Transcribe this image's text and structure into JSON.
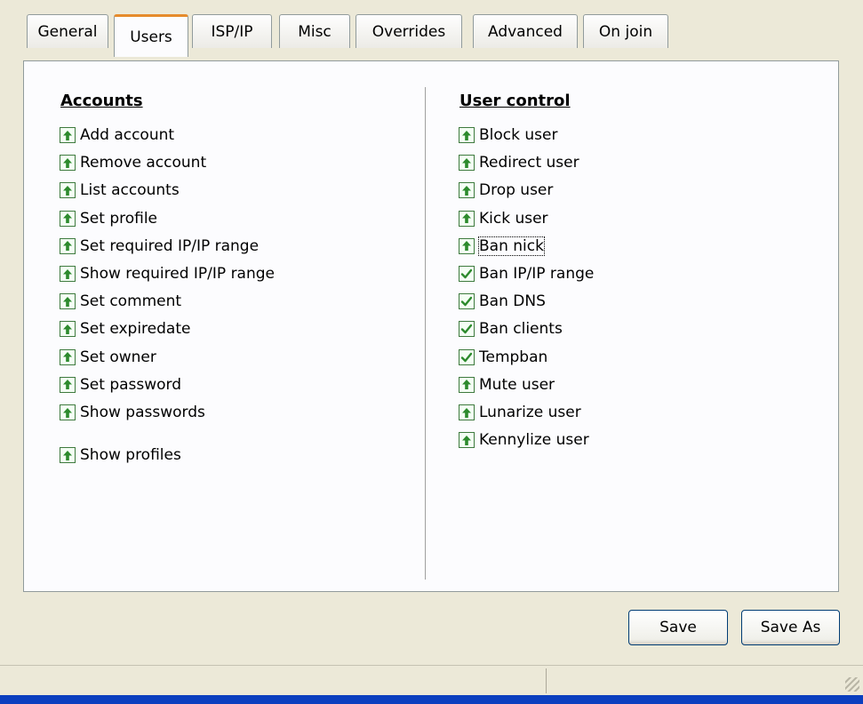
{
  "tabs": [
    "General",
    "Users",
    "ISP/IP",
    "Misc",
    "Overrides",
    "Advanced",
    "On join"
  ],
  "active_tab": "Users",
  "accounts": {
    "heading": "Accounts",
    "items": [
      {
        "label": "Add account",
        "state": "up"
      },
      {
        "label": "Remove account",
        "state": "up"
      },
      {
        "label": "List accounts",
        "state": "up"
      },
      {
        "label": "Set profile",
        "state": "up"
      },
      {
        "label": "Set required IP/IP range",
        "state": "up"
      },
      {
        "label": "Show required IP/IP range",
        "state": "up"
      },
      {
        "label": "Set comment",
        "state": "up"
      },
      {
        "label": "Set expiredate",
        "state": "up"
      },
      {
        "label": "Set owner",
        "state": "up"
      },
      {
        "label": "Set password",
        "state": "up"
      },
      {
        "label": "Show passwords",
        "state": "up"
      },
      {
        "label": "Show profiles",
        "state": "up"
      }
    ]
  },
  "user_control": {
    "heading": "User control",
    "items": [
      {
        "label": "Block user",
        "state": "up"
      },
      {
        "label": "Redirect user",
        "state": "up"
      },
      {
        "label": "Drop user",
        "state": "up"
      },
      {
        "label": "Kick user",
        "state": "up"
      },
      {
        "label": "Ban nick",
        "state": "up",
        "focused": true
      },
      {
        "label": "Ban IP/IP range",
        "state": "check"
      },
      {
        "label": "Ban DNS",
        "state": "check"
      },
      {
        "label": "Ban clients",
        "state": "check"
      },
      {
        "label": "Tempban",
        "state": "check"
      },
      {
        "label": "Mute user",
        "state": "up"
      },
      {
        "label": "Lunarize user",
        "state": "up"
      },
      {
        "label": "Kennylize user",
        "state": "up"
      }
    ]
  },
  "buttons": {
    "save": "Save",
    "save_as": "Save As"
  },
  "colors": {
    "icon_green": "#2d8a2d",
    "tab_accent": "#e68b2c",
    "taskbar": "#0b3fbf"
  }
}
